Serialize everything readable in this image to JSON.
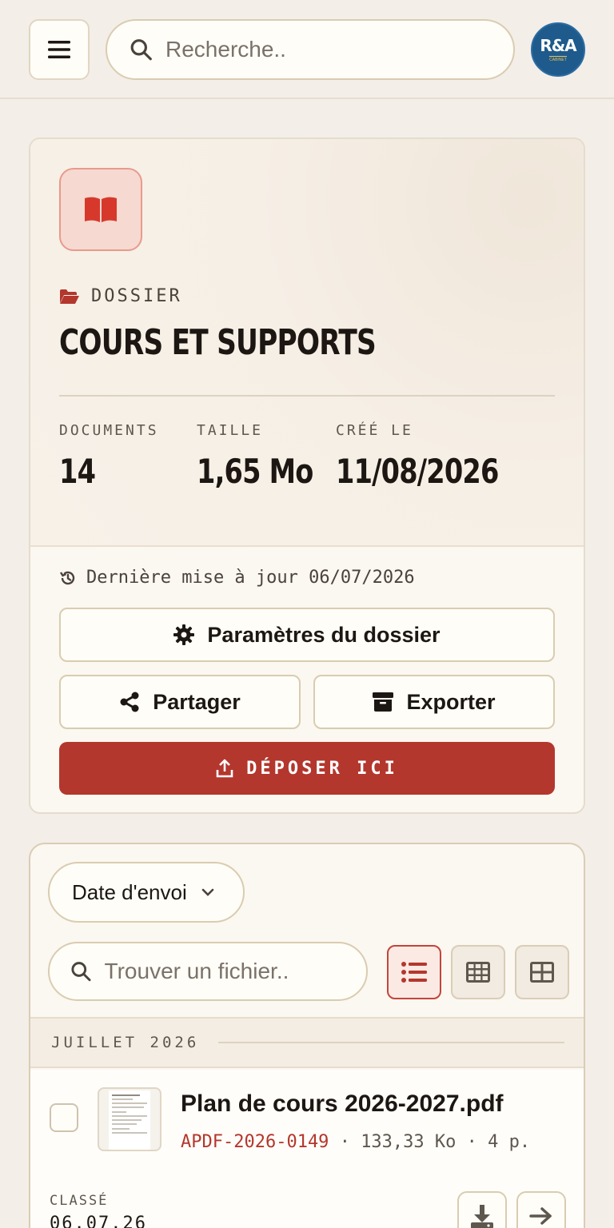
{
  "header": {
    "search_placeholder": "Recherche..",
    "avatar_initials": "R&A",
    "avatar_subtitle": "CABINET"
  },
  "folder": {
    "kicker": "DOSSIER",
    "title": "COURS ET SUPPORTS",
    "stats": [
      {
        "label": "DOCUMENTS",
        "value": "14"
      },
      {
        "label": "TAILLE",
        "value": "1,65 Mo"
      },
      {
        "label": "CRÉÉ LE",
        "value": "11/08/2026"
      }
    ],
    "updated": "Dernière mise à jour 06/07/2026",
    "buttons": {
      "settings": "Paramètres du dossier",
      "share": "Partager",
      "export": "Exporter",
      "drop": "DÉPOSER ICI"
    }
  },
  "files": {
    "sort_label": "Date d'envoi",
    "search_placeholder": "Trouver un fichier..",
    "active_view": "list",
    "month_label": "JUILLET 2026",
    "items": [
      {
        "name": "Plan de cours 2026-2027.pdf",
        "ref": "APDF-2026-0149",
        "size": "133,33 Ko",
        "pages": "4 p.",
        "status_label": "CLASSÉ",
        "status_date": "06.07.26"
      }
    ]
  },
  "colors": {
    "accent": "#b3372d",
    "background": "#f4eee8",
    "avatar": "#1e5a8c"
  }
}
